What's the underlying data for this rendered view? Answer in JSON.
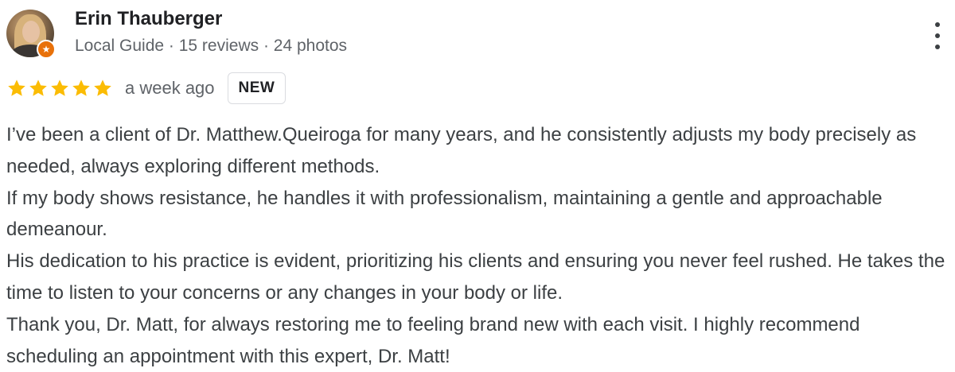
{
  "reviewer": {
    "name": "Erin Thauberger",
    "meta": "Local Guide · 15 reviews · 24 photos"
  },
  "review": {
    "rating": 5,
    "rating_max": 5,
    "time_ago": "a week ago",
    "tag": "NEW",
    "paragraphs": [
      "I’ve been a client of Dr. Matthew.Queiroga for many years, and he consistently adjusts my body precisely as needed, always exploring different methods.",
      "If my body shows resistance, he handles it with professionalism, maintaining a gentle and approachable demeanour.",
      "His dedication to his practice is evident, prioritizing his clients and ensuring you never feel rushed. He takes the time to listen to your concerns or any changes in your body or life.",
      "Thank you, Dr. Matt, for always restoring me to feeling brand new with each visit. I highly recommend scheduling an appointment with this expert, Dr. Matt!"
    ]
  },
  "icons": {
    "star": "star-icon",
    "badge": "local-guide-star-icon",
    "more": "more-vert-icon"
  },
  "colors": {
    "star": "#fbbc04",
    "badge": "#e8710a",
    "text": "#3c4043",
    "meta": "#5f6368"
  }
}
